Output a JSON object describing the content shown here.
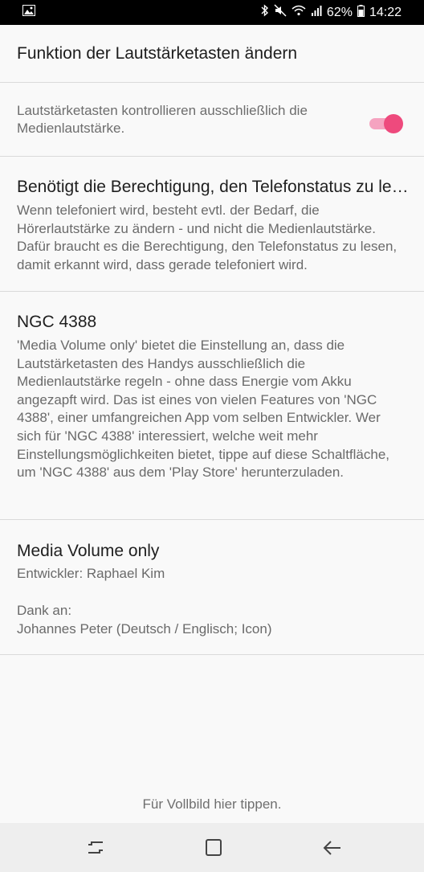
{
  "status_bar": {
    "battery_percent": "62%",
    "time": "14:22",
    "icons": [
      "image-icon",
      "bluetooth-icon",
      "mute-icon",
      "wifi-icon",
      "signal-icon",
      "battery-icon"
    ]
  },
  "settings": {
    "volume_keys_title": "Funktion der Lautstärketasten ändern",
    "media_only_desc": "Lautstärketasten kontrollieren ausschließlich die Medienlautstärke.",
    "media_only_enabled": true,
    "accent_color": "#ee4a7d"
  },
  "permission": {
    "title": "Benötigt die Berechtigung, den Telefonstatus zu lesen",
    "body": "Wenn telefoniert wird, besteht evtl. der Bedarf, die Hörerlautstärke zu ändern - und nicht die Medienlautstärke. Dafür braucht es die Berechtigung, den Telefonstatus zu lesen, damit erkannt wird, dass gerade telefoniert wird."
  },
  "promo": {
    "title": "NGC 4388",
    "body": "'Media Volume only' bietet die Einstellung an, dass die Lautstärketasten des Handys ausschließlich die Medienlautstärke regeln - ohne dass Energie vom Akku angezapft wird. Das ist eines von vielen Features von 'NGC 4388', einer umfangreichen App vom selben Entwickler. Wer sich für 'NGC 4388' interessiert, welche weit mehr Einstellungsmöglichkeiten bietet, tippe auf diese Schaltfläche, um 'NGC 4388' aus dem 'Play Store' herunterzuladen."
  },
  "about": {
    "app_name": "Media Volume only",
    "developer": "Entwickler: Raphael Kim",
    "thanks_label": "Dank an:",
    "thanks_names": "Johannes Peter (Deutsch / Englisch; Icon)"
  },
  "footer": {
    "fullscreen_hint": "Für Vollbild hier tippen."
  },
  "nav_bar": {
    "buttons": [
      "recent-apps-icon",
      "home-icon",
      "back-icon"
    ]
  }
}
